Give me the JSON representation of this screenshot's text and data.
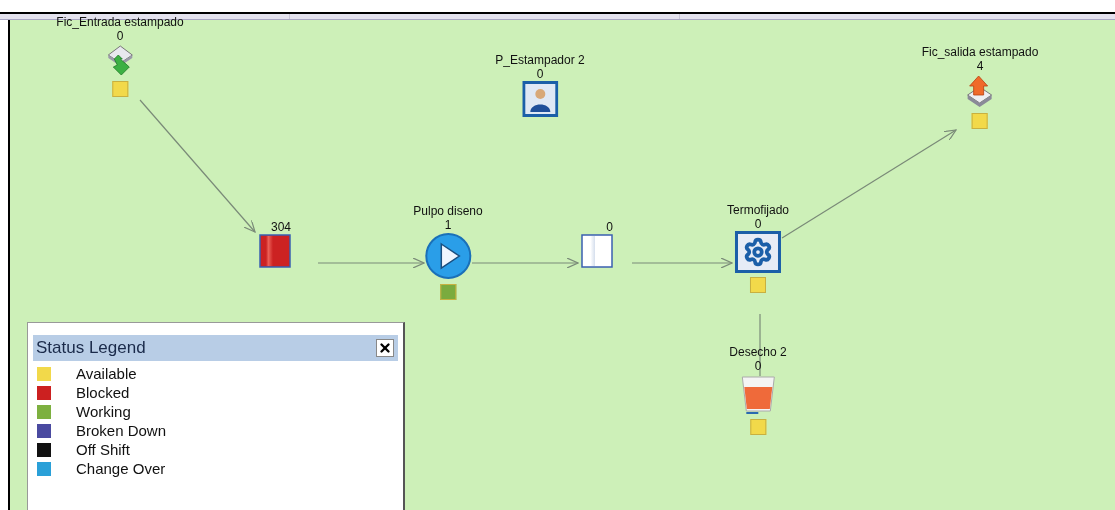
{
  "nodes": [
    {
      "kind": "source",
      "name": "Fic_Entrada estampado",
      "count": "0",
      "color": "#f2d94a"
    },
    {
      "kind": "resource",
      "name": "P_Estampador 2",
      "count": "0"
    },
    {
      "kind": "sink",
      "name": "Fic_salida estampado",
      "count": "4",
      "color": "#f2d94a"
    },
    {
      "kind": "buffer",
      "count": "304",
      "color": "#cc2222"
    },
    {
      "kind": "activity",
      "name": "Pulpo diseno",
      "count": "1",
      "color": "#7aab3e"
    },
    {
      "kind": "buffer",
      "count": "0",
      "color": "#ffffff"
    },
    {
      "kind": "workstation",
      "name": "Termofijado",
      "count": "0",
      "color": "#f2d94a"
    },
    {
      "kind": "waste",
      "name": "Desecho 2",
      "count": "0",
      "color": "#f2d94a"
    }
  ],
  "legend": {
    "title": "Status Legend",
    "items": [
      {
        "label": "Available",
        "color": "#f2d94a"
      },
      {
        "label": "Blocked",
        "color": "#cc2020"
      },
      {
        "label": "Working",
        "color": "#7db040"
      },
      {
        "label": "Broken Down",
        "color": "#4a4aa0"
      },
      {
        "label": "Off Shift",
        "color": "#111111"
      },
      {
        "label": "Change Over",
        "color": "#2aa0d8"
      }
    ]
  }
}
